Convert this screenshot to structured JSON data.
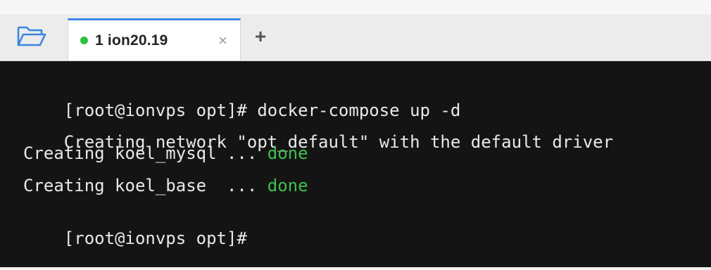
{
  "tabs": [
    {
      "label": "1 ion20.19",
      "status_color": "#2ec13c",
      "close_glyph": "×"
    }
  ],
  "tabbar": {
    "add_glyph": "+"
  },
  "terminal": {
    "lines": [
      {
        "text": "[root@ionvps opt]# docker-compose up -d",
        "status": ""
      },
      {
        "text": "Creating network \"opt_default\" with the default driver",
        "status": ""
      },
      {
        "text": "Creating koel_mysql ... ",
        "status": "done"
      },
      {
        "text": "Creating koel_base  ... ",
        "status": "done"
      },
      {
        "text": "[root@ionvps opt]#",
        "status": ""
      }
    ]
  },
  "colors": {
    "accent": "#3b86e6",
    "success": "#3fbf4f",
    "terminal_bg": "#141414"
  }
}
